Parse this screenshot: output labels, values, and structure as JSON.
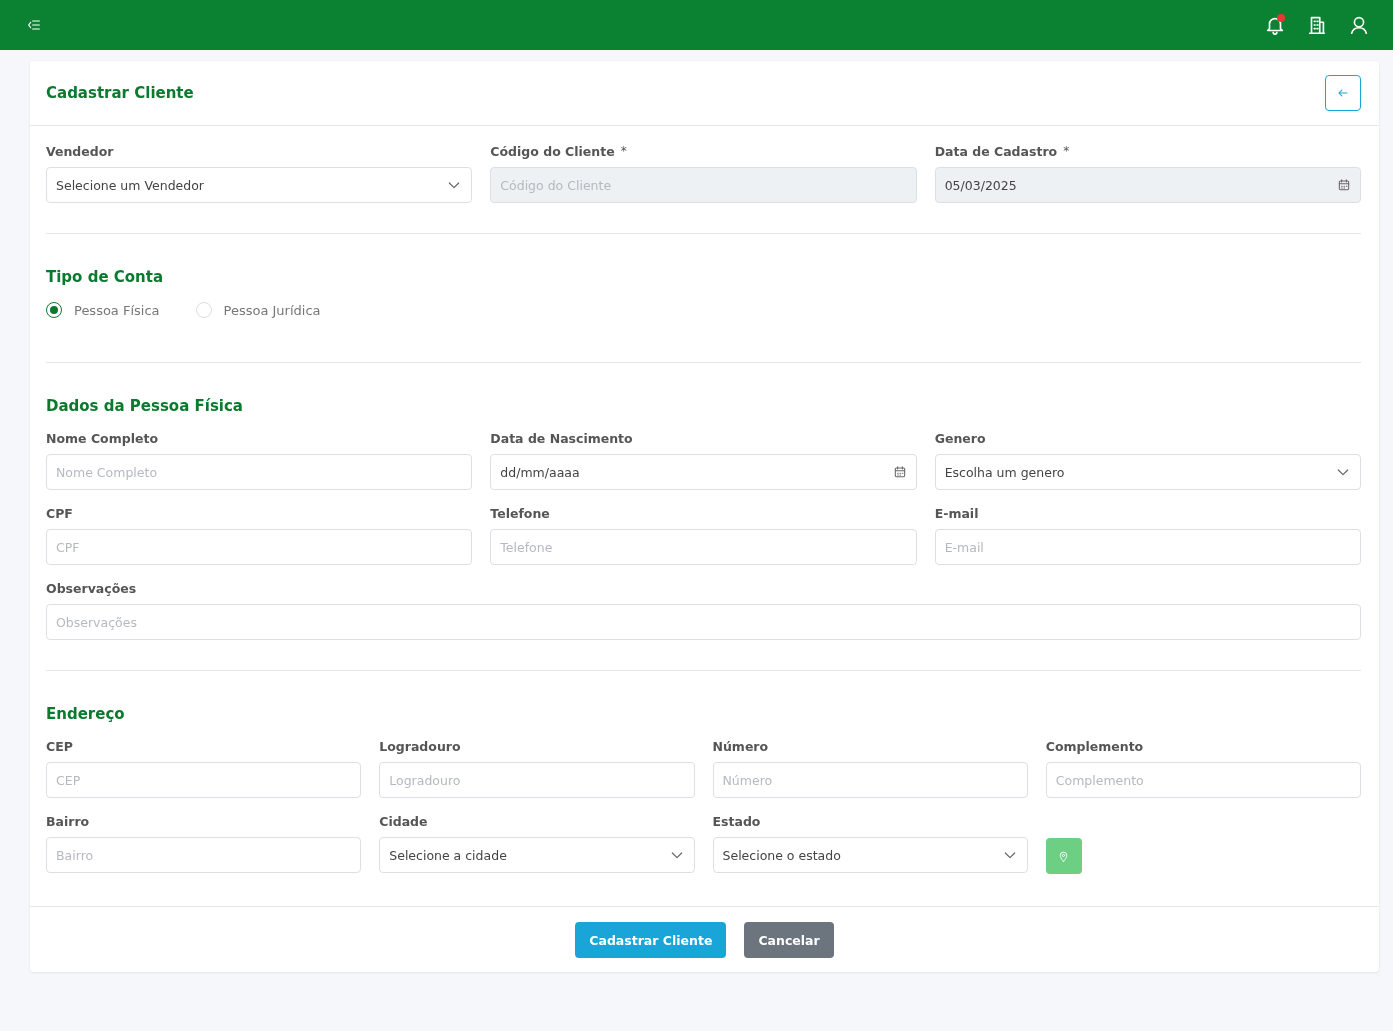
{
  "topbar": {
    "notification_dot": true
  },
  "page": {
    "title": "Cadastrar Cliente"
  },
  "sections": [
    {
      "rows": [
        [
          {
            "kind": "select",
            "label": "Vendedor",
            "value": "Selecione um Vendedor",
            "disabled": false
          },
          {
            "kind": "input",
            "label": "Código do Cliente",
            "required_mark": "*",
            "placeholder": "Código do Cliente",
            "disabled": true
          },
          {
            "kind": "date",
            "label": "Data de Cadastro",
            "required_mark": "*",
            "value": "05/03/2025",
            "disabled": true
          }
        ]
      ]
    },
    {
      "title": "Tipo de Conta",
      "radios": [
        {
          "label": "Pessoa Física",
          "selected": true
        },
        {
          "label": "Pessoa Jurídica",
          "selected": false
        }
      ]
    },
    {
      "title": "Dados da Pessoa Física",
      "rows": [
        [
          {
            "kind": "input",
            "label": "Nome Completo",
            "placeholder": "Nome Completo",
            "disabled": false
          },
          {
            "kind": "date",
            "label": "Data de Nascimento",
            "value": "dd/mm/aaaa",
            "disabled": false
          },
          {
            "kind": "select",
            "label": "Genero",
            "value": "Escolha um genero",
            "disabled": false
          }
        ],
        [
          {
            "kind": "input",
            "label": "CPF",
            "placeholder": "CPF",
            "disabled": false
          },
          {
            "kind": "input",
            "label": "Telefone",
            "placeholder": "Telefone",
            "disabled": false
          },
          {
            "kind": "input",
            "label": "E-mail",
            "placeholder": "E-mail",
            "disabled": false
          }
        ],
        [
          {
            "kind": "input",
            "label": "Observações",
            "placeholder": "Observações",
            "disabled": false
          }
        ]
      ]
    },
    {
      "title": "Endereço",
      "rows": [
        [
          {
            "kind": "input",
            "label": "CEP",
            "placeholder": "CEP",
            "disabled": false
          },
          {
            "kind": "input",
            "label": "Logradouro",
            "placeholder": "Logradouro",
            "disabled": false
          },
          {
            "kind": "input",
            "label": "Número",
            "placeholder": "Número",
            "disabled": false
          },
          {
            "kind": "input",
            "label": "Complemento",
            "placeholder": "Complemento",
            "disabled": false
          }
        ],
        [
          {
            "kind": "input",
            "label": "Bairro",
            "placeholder": "Bairro",
            "disabled": false
          },
          {
            "kind": "select",
            "label": "Cidade",
            "value": "Selecione a cidade",
            "disabled": false
          },
          {
            "kind": "select",
            "label": "Estado",
            "value": "Selecione o estado",
            "disabled": false
          },
          {
            "kind": "map-button"
          }
        ]
      ]
    }
  ],
  "buttons": [
    {
      "kind": "primary",
      "label": "Cadastrar Cliente"
    },
    {
      "kind": "secondary",
      "label": "Cancelar"
    }
  ]
}
